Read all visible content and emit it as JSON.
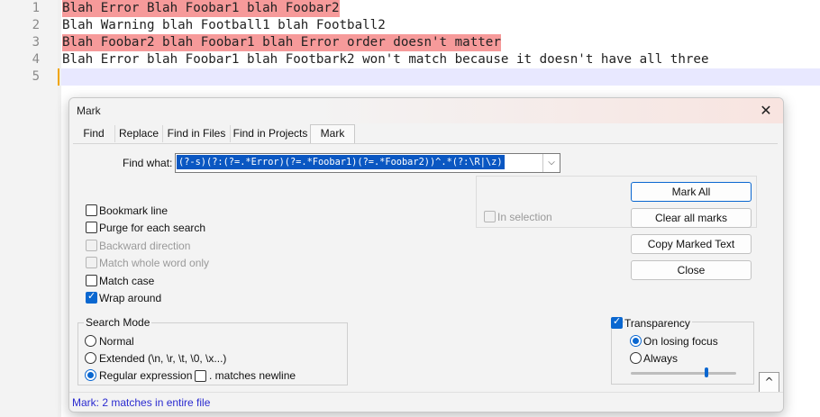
{
  "editor": {
    "lines": [
      {
        "num": "1",
        "text": "Blah Error Blah Foobar1 blah Foobar2",
        "marked": true
      },
      {
        "num": "2",
        "text": "Blah Warning blah Football1 blah Football2",
        "marked": false
      },
      {
        "num": "3",
        "text": "Blah Foobar2 blah Foobar1 blah Error order doesn't matter",
        "marked": true
      },
      {
        "num": "4",
        "text": "Blah Error blah Foobar1 blah Footbark2 won't match because it doesn't have all three",
        "marked": false
      },
      {
        "num": "5",
        "text": "",
        "marked": false
      }
    ],
    "mark_color": "#f69a9a"
  },
  "dialog": {
    "title": "Mark",
    "tabs": [
      "Find",
      "Replace",
      "Find in Files",
      "Find in Projects",
      "Mark"
    ],
    "active_tab": "Mark",
    "find_what_label": "Find what:",
    "find_what_value": "(?-s)(?:(?=.*Error)(?=.*Foobar1)(?=.*Foobar2))^.*(?:\\R|\\z)",
    "options": {
      "bookmark_line": "Bookmark line",
      "purge": "Purge for each search",
      "backward": "Backward direction",
      "whole_word": "Match whole word only",
      "match_case": "Match case",
      "wrap_around": "Wrap around"
    },
    "in_selection": "In selection",
    "buttons": {
      "mark_all": "Mark All",
      "clear_marks": "Clear all marks",
      "copy_marked": "Copy Marked Text",
      "close": "Close"
    },
    "search_mode": {
      "title": "Search Mode",
      "normal": "Normal",
      "extended": "Extended (\\n, \\r, \\t, \\0, \\x...)",
      "regex": "Regular expression",
      "matches_newline": ". matches newline"
    },
    "transparency": {
      "title": "Transparency",
      "on_losing_focus": "On losing focus",
      "always": "Always",
      "level": 0.7
    },
    "expand_glyph": "^",
    "status": "Mark: 2 matches in entire file"
  }
}
